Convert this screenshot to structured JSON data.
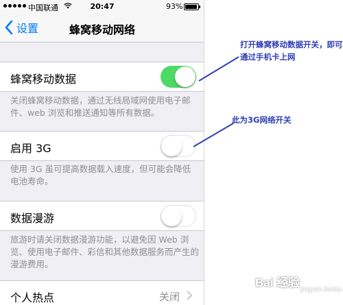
{
  "status_bar": {
    "carrier": "中国联通",
    "time": "20:47",
    "battery_percent_label": "93%",
    "battery_level": 0.93,
    "icons": [
      "signal-dots-icon",
      "wifi-icon",
      "battery-icon"
    ]
  },
  "nav": {
    "back_label": "设置",
    "title": "蜂窝移动网络"
  },
  "settings": {
    "cellular_data": {
      "label": "蜂窝移动数据",
      "enabled": true,
      "footer": "关闭蜂窝移动数据，通过无线局域网使用电子邮件、web 浏览和推送通知等所有数据。"
    },
    "enable_3g": {
      "label": "启用 3G",
      "enabled": false,
      "footer": "使用 3G 虽可提高数据载入速度，但可能会降低电池寿命。"
    },
    "data_roaming": {
      "label": "数据漫游",
      "enabled": false,
      "footer": "旅游时请关闭数据漫游功能，以避免因 Web 浏览、使用电子邮件、彩信和其他数据服务而产生的漫游费用。"
    },
    "personal_hotspot": {
      "label": "个人热点",
      "value": "关闭"
    }
  },
  "annotations": {
    "cellular_note_line1": "打开蜂窝移动数据开关，即可",
    "cellular_note_line2": "通过手机卡上网",
    "g3_note": "此为3G网络开关"
  },
  "watermark": {
    "text": "Bai 经验",
    "sub": "jingyan.baidu.com"
  },
  "colors": {
    "accent": "#007aff",
    "switch_on": "#4cd964",
    "annotation": "#2f3fb3",
    "background": "#efeff4"
  }
}
